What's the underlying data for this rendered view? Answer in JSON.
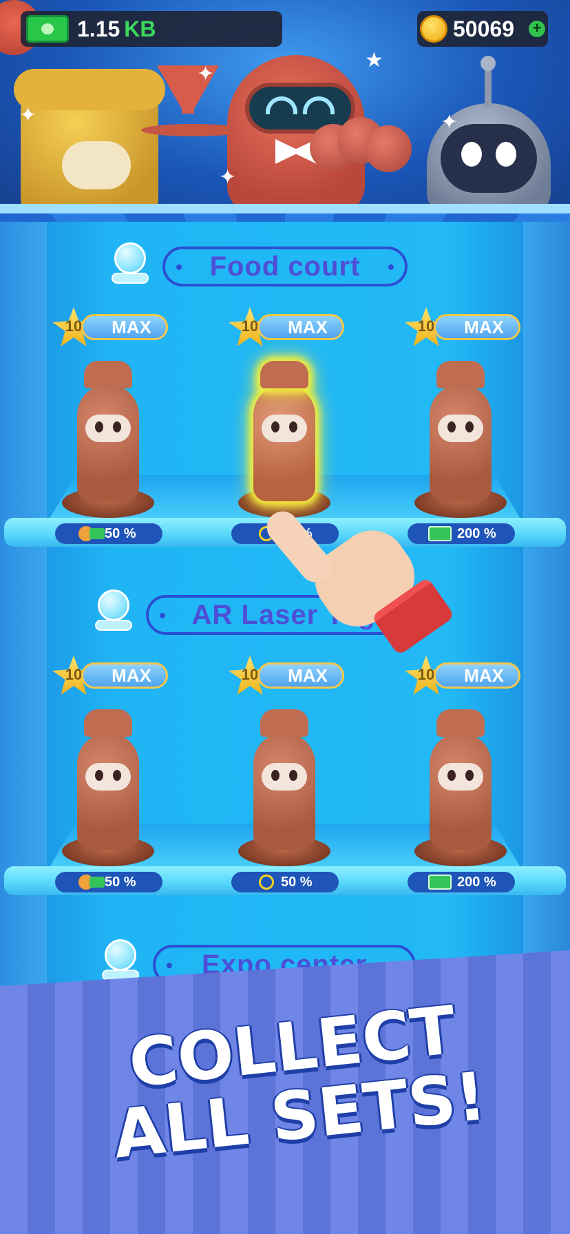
{
  "hud": {
    "money_value": "1.15",
    "money_unit": "KB",
    "coins": "50069",
    "add_coins_label": "+"
  },
  "sections": [
    {
      "title": "Food court",
      "items": [
        {
          "level": "10",
          "status": "MAX",
          "bonus_icon": "upgrade-cash-icon",
          "bonus": "50 %"
        },
        {
          "level": "10",
          "status": "MAX",
          "bonus_icon": "timer-icon",
          "bonus": "50 %"
        },
        {
          "level": "10",
          "status": "MAX",
          "bonus_icon": "cash-icon",
          "bonus": "200 %"
        }
      ]
    },
    {
      "title": "AR Laser Tag",
      "items": [
        {
          "level": "10",
          "status": "MAX",
          "bonus_icon": "upgrade-cash-icon",
          "bonus": "50 %"
        },
        {
          "level": "10",
          "status": "MAX",
          "bonus_icon": "timer-icon",
          "bonus": "50 %"
        },
        {
          "level": "10",
          "status": "MAX",
          "bonus_icon": "cash-icon",
          "bonus": "200 %"
        }
      ]
    },
    {
      "title": "Expo center"
    }
  ],
  "promo": {
    "line1": "COLLECT",
    "line2": "ALL SETS!"
  },
  "colors": {
    "background": "#1f6fd6",
    "accent_title": "#4d4fd6",
    "bonus_pill": "#1f55b8",
    "cash_green": "#34c55a",
    "star_gold": "#f0b21c",
    "glow": "#f4ef3c"
  }
}
